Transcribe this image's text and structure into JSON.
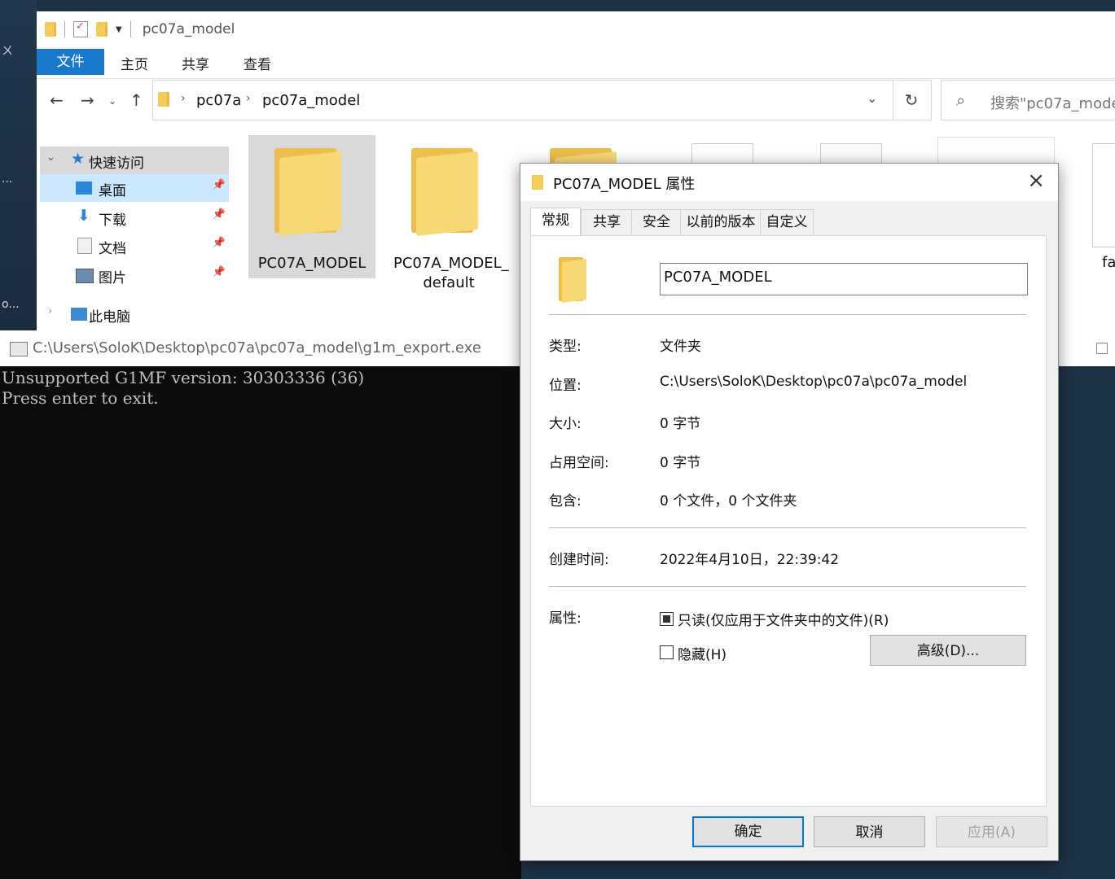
{
  "desktop": {
    "fragments": [
      "ㄨ",
      "...",
      "o..."
    ]
  },
  "explorer": {
    "title": "pc07a_model",
    "ribbon_tabs": [
      "文件",
      "主页",
      "共享",
      "查看"
    ],
    "breadcrumb": [
      "pc07a",
      "pc07a_model"
    ],
    "search_placeholder": "搜索\"pc07a_mode",
    "nav": {
      "quick_access": "快速访问",
      "items": [
        "桌面",
        "下载",
        "文档",
        "图片"
      ],
      "this_pc": "此电脑"
    },
    "files": [
      "PC07A_MODEL",
      "PC07A_MODEL_ default"
    ],
    "partial_file_label": "fa"
  },
  "console": {
    "title": "C:\\Users\\SoloK\\Desktop\\pc07a\\pc07a_model\\g1m_export.exe",
    "lines": "Unsupported G1MF version: 30303336 (36)\nPress enter to exit."
  },
  "dialog": {
    "title": "PC07A_MODEL 属性",
    "tabs": [
      "常规",
      "共享",
      "安全",
      "以前的版本",
      "自定义"
    ],
    "name_value": "PC07A_MODEL",
    "props": {
      "type_label": "类型:",
      "type_value": "文件夹",
      "location_label": "位置:",
      "location_value": "C:\\Users\\SoloK\\Desktop\\pc07a\\pc07a_model",
      "size_label": "大小:",
      "size_value": "0 字节",
      "disk_label": "占用空间:",
      "disk_value": "0 字节",
      "contains_label": "包含:",
      "contains_value": "0 个文件，0 个文件夹",
      "created_label": "创建时间:",
      "created_value": "2022年4月10日，22:39:42",
      "attr_label": "属性:",
      "readonly_label": "只读(仅应用于文件夹中的文件)(R)",
      "hidden_label": "隐藏(H)",
      "advanced_label": "高级(D)..."
    },
    "buttons": {
      "ok": "确定",
      "cancel": "取消",
      "apply": "应用(A)"
    }
  }
}
